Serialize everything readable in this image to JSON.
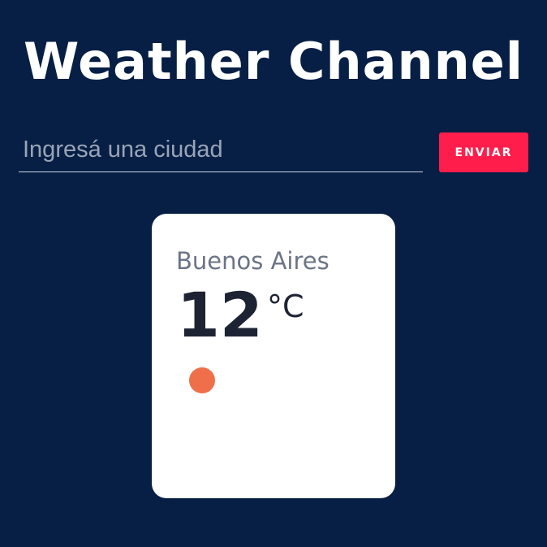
{
  "header": {
    "title": "Weather Channel"
  },
  "search": {
    "value": "",
    "placeholder": "Ingresá una ciudad",
    "button_label": "ENVIAR"
  },
  "weather": {
    "city": "Buenos Aires",
    "temperature": "12",
    "unit": "°C",
    "icon": "sun-icon"
  },
  "colors": {
    "background": "#071f45",
    "button": "#ff1e4b",
    "card": "#ffffff",
    "sun": "#ef6f4b"
  }
}
